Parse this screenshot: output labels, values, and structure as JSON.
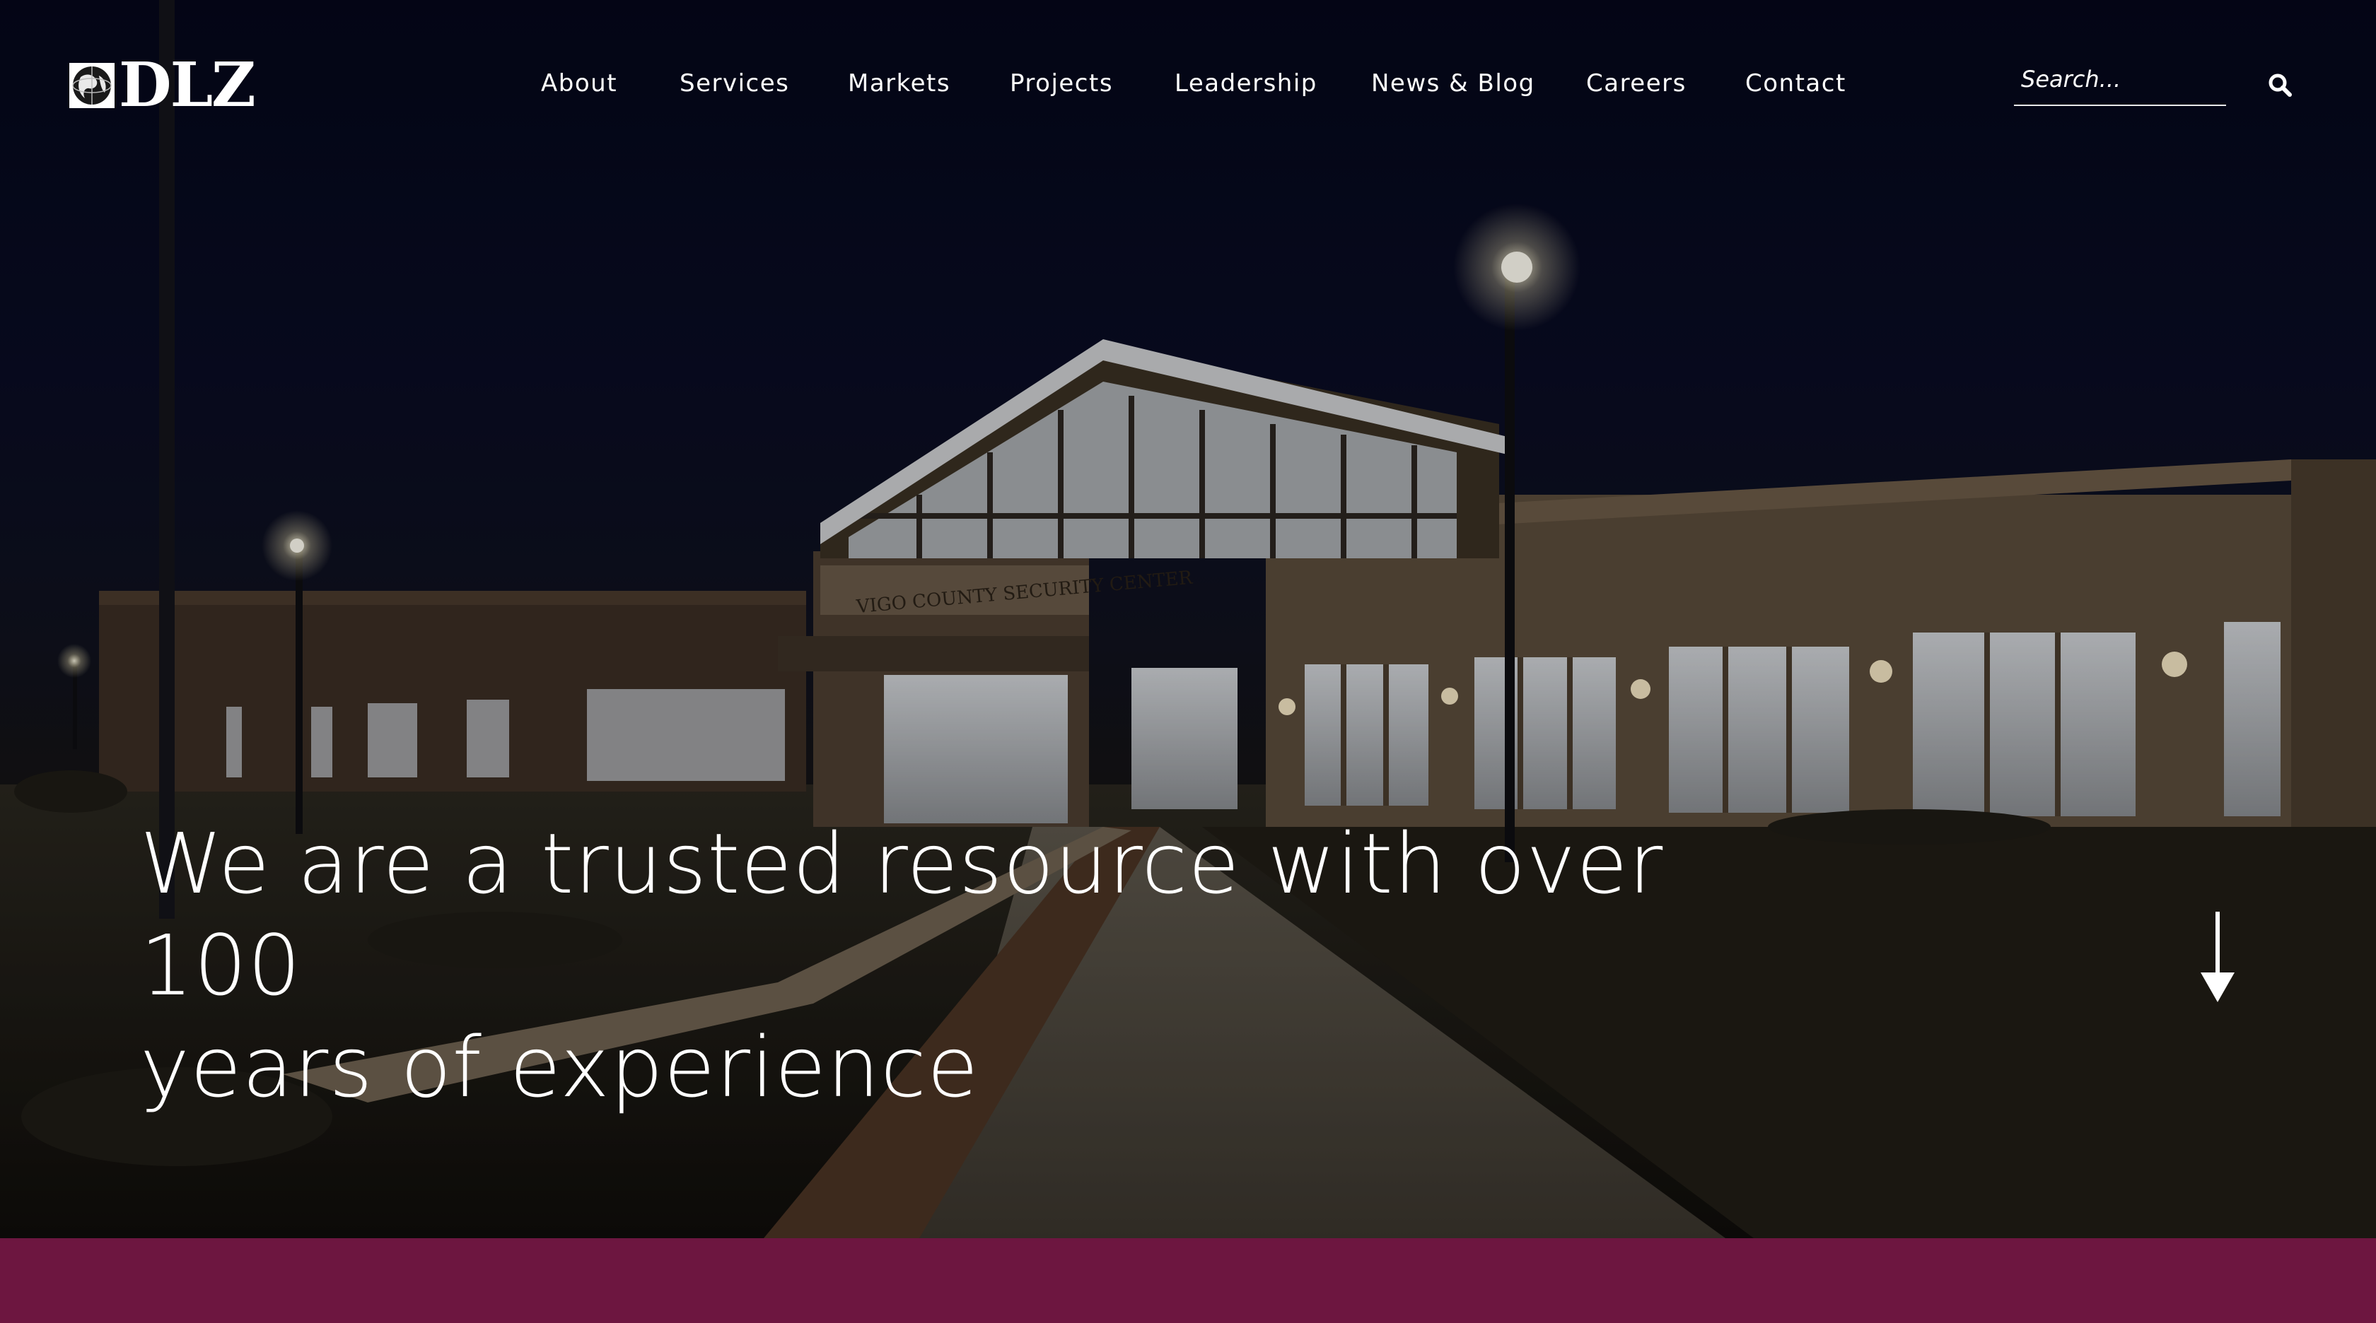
{
  "brand": {
    "logo_text": "DLZ"
  },
  "nav": {
    "items": [
      {
        "label": "About"
      },
      {
        "label": "Services"
      },
      {
        "label": "Markets"
      },
      {
        "label": "Projects"
      },
      {
        "label": "Leadership"
      },
      {
        "label": "News & Blog"
      },
      {
        "label": "Careers"
      },
      {
        "label": "Contact"
      }
    ]
  },
  "search": {
    "placeholder": "Search...",
    "value": ""
  },
  "hero": {
    "headline_line1": "We are a trusted resource with over 100",
    "headline_line2": "years of experience",
    "building_sign": "VIGO COUNTY SECURITY CENTER"
  },
  "icons": {
    "search": "search-icon",
    "scroll": "arrow-down-icon",
    "logo": "globe-icon"
  },
  "colors": {
    "accent_band": "#6d1640",
    "text": "#ffffff",
    "overlay": "#0b0e1e"
  }
}
